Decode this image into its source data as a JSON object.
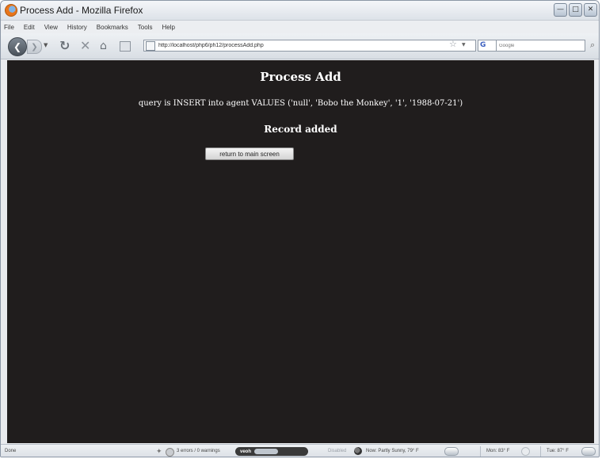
{
  "window": {
    "title": "Process Add - Mozilla Firefox",
    "controls": [
      "minimize",
      "maximize",
      "close"
    ]
  },
  "menu": {
    "items": [
      "File",
      "Edit",
      "View",
      "History",
      "Bookmarks",
      "Tools",
      "Help"
    ]
  },
  "toolbar": {
    "url": "http://localhost/php6/ph12/processAdd.php",
    "search_placeholder": "Google",
    "search_engine_label": "G"
  },
  "page": {
    "heading": "Process Add",
    "query_text": "query is INSERT into agent VALUES ('null', 'Bobo the Monkey', '1', '1988-07-21')",
    "status_message": "Record added",
    "return_button": "return to main screen"
  },
  "statusbar": {
    "status": "Done",
    "errors": "3 errors / 0 warnings",
    "veoh_label": "veoh",
    "addon_state": "Disabled",
    "weather_now": "Now: Partly Sunny, 79° F",
    "weather_mon": "Mon: 83° F",
    "weather_tue": "Tue: 87° F"
  },
  "colors": {
    "content_background": "#201d1d",
    "content_text": "#ffffff",
    "chrome_background": "#e9ebee"
  }
}
